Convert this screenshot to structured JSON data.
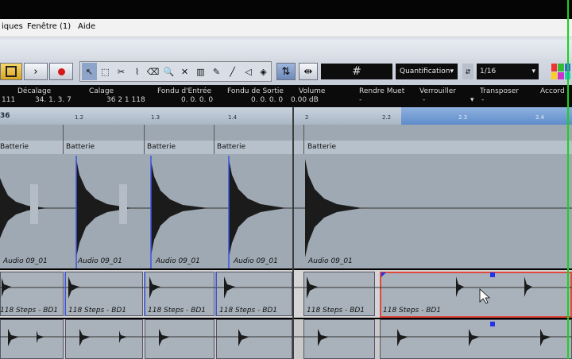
{
  "menu": {
    "items": [
      "iques",
      "Fenêtre (1)",
      "Aide"
    ]
  },
  "toolbar": {
    "quantize_label": "Quantification",
    "quantize_value": "1/16"
  },
  "infoline": {
    "fields": [
      {
        "label": "Décalage",
        "value": "34.  1.  3.   7"
      },
      {
        "label": "Calage",
        "value": "36   2   1 118"
      },
      {
        "label": "Fondu d'Entrée",
        "value": "0.  0.  0.  0"
      },
      {
        "label": "Fondu de Sortie",
        "value": "0.  0.  0.  0"
      },
      {
        "label": "Volume",
        "value": "0.00 dB"
      },
      {
        "label": "Rendre Muet",
        "value": "-"
      },
      {
        "label": "Verrouiller",
        "value": "-"
      },
      {
        "label": "Transposer",
        "value": "-"
      },
      {
        "label": "Accord",
        "value": ""
      }
    ],
    "left_value": "111"
  },
  "ruler": {
    "marks": [
      "36",
      "1.2",
      "1.3",
      "1.4",
      "2",
      "2.2",
      "2.3",
      "2.4"
    ]
  },
  "tracks": {
    "batterie_label": "Batterie",
    "audio_event_name": "Audio 09_01",
    "steps_event_name": "118 Steps - BD1"
  },
  "colors": {
    "green_line": "#17d41b",
    "selection_red": "#e0483f",
    "handle_blue": "#2433e6"
  }
}
